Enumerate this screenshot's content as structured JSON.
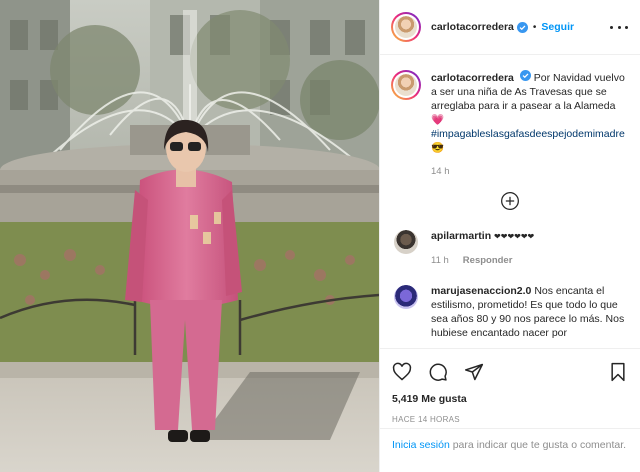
{
  "post": {
    "image_alt": "Vintage photo of a woman in a pink outfit in front of a fountain"
  },
  "header": {
    "username": "carlotacorredera",
    "separator": "•",
    "follow_label": "Seguir"
  },
  "caption": {
    "username": "carlotacorredera",
    "text": "Por Navidad vuelvo a ser una niña de As Travesas que se arreglaba para ir a pasear a la Alameda",
    "emoji1": "💗",
    "hashtag": "#impagableslasgafasdeespejodemimadre",
    "emoji2": "😎",
    "time": "14 h"
  },
  "comments": [
    {
      "username": "apilarmartin",
      "text": "❤❤❤❤❤❤",
      "time": "11 h",
      "reply_label": "Responder"
    },
    {
      "username": "marujasenaccion2.0",
      "text": "Nos encanta el estilismo, prometido! Es que todo lo que sea años 80 y 90 nos parece lo más. Nos hubiese encantado nacer por"
    }
  ],
  "actions": {
    "likes": "5,419 Me gusta",
    "ago": "HACE 14 HORAS"
  },
  "login": {
    "link": "Inicia sesión",
    "text": " para indicar que te gusta o comentar."
  },
  "colors": {
    "accent": "#0095f6",
    "hashtag": "#00376b",
    "muted": "#8e8e8e",
    "border": "#efefef"
  }
}
